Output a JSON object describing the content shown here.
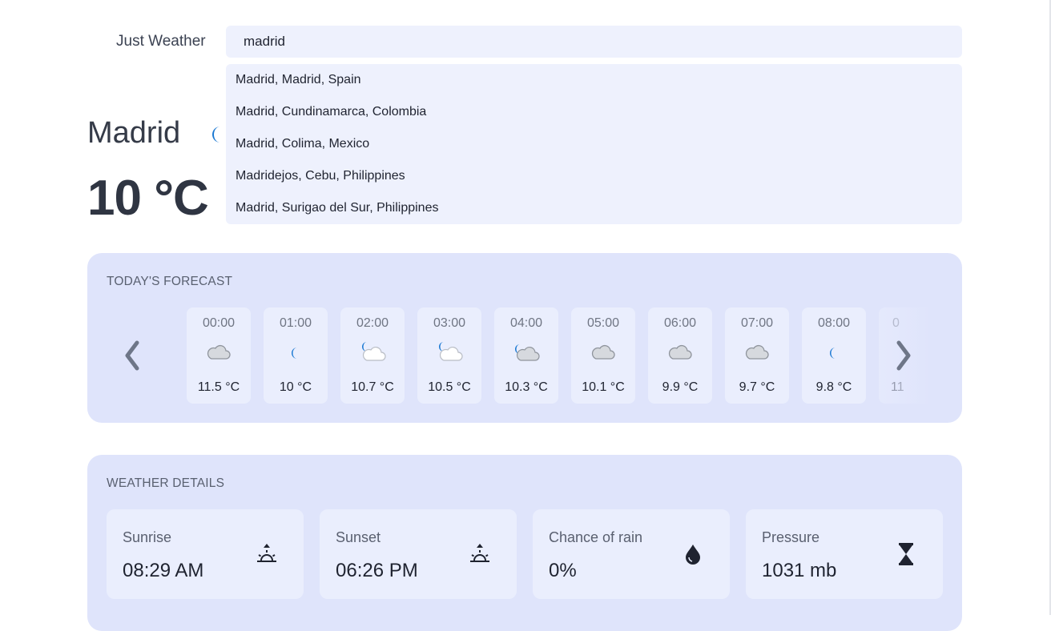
{
  "header": {
    "app_title": "Just Weather",
    "search_value": "madrid"
  },
  "suggestions": [
    "Madrid, Madrid, Spain",
    "Madrid, Cundinamarca, Colombia",
    "Madrid, Colima, Mexico",
    "Madridejos, Cebu, Philippines",
    "Madrid, Surigao del Sur, Philippines"
  ],
  "current": {
    "city": "Madrid",
    "temperature": "10 °C",
    "icon": "moon-icon"
  },
  "forecast": {
    "title": "TODAY'S FORECAST",
    "hours": [
      {
        "time": "00:00",
        "temp": "11.5 °C",
        "icon": "cloud"
      },
      {
        "time": "01:00",
        "temp": "10 °C",
        "icon": "moon"
      },
      {
        "time": "02:00",
        "temp": "10.7 °C",
        "icon": "moon-cloud-light"
      },
      {
        "time": "03:00",
        "temp": "10.5 °C",
        "icon": "moon-cloud-light"
      },
      {
        "time": "04:00",
        "temp": "10.3 °C",
        "icon": "moon-cloud"
      },
      {
        "time": "05:00",
        "temp": "10.1 °C",
        "icon": "cloud"
      },
      {
        "time": "06:00",
        "temp": "9.9 °C",
        "icon": "cloud"
      },
      {
        "time": "07:00",
        "temp": "9.7 °C",
        "icon": "cloud"
      },
      {
        "time": "08:00",
        "temp": "9.8 °C",
        "icon": "moon"
      },
      {
        "time": "0",
        "temp": "11",
        "icon": "none"
      }
    ]
  },
  "details": {
    "title": "WEATHER DETAILS",
    "cards": [
      {
        "label": "Sunrise",
        "value": "08:29 AM",
        "icon": "sunrise-icon"
      },
      {
        "label": "Sunset",
        "value": "06:26 PM",
        "icon": "sunset-icon"
      },
      {
        "label": "Chance of rain",
        "value": "0%",
        "icon": "raindrop-icon"
      },
      {
        "label": "Pressure",
        "value": "1031 mb",
        "icon": "pressure-icon"
      }
    ]
  },
  "colors": {
    "accent_blue": "#1877d2",
    "panel_bg": "#dfe4fb",
    "card_bg": "#eaeefd"
  }
}
